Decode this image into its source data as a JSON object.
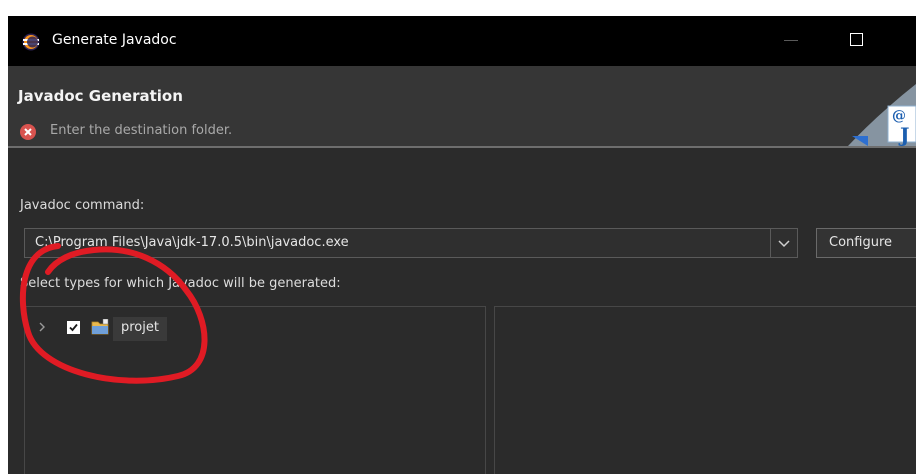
{
  "window": {
    "title": "Generate Javadoc"
  },
  "banner": {
    "title": "Javadoc Generation",
    "message": "Enter the destination folder."
  },
  "form": {
    "javadoc_command_label": "Javadoc command:",
    "javadoc_command_value": "C:\\Program Files\\Java\\jdk-17.0.5\\bin\\javadoc.exe",
    "configure_label": "Configure",
    "types_label": "Select types for which Javadoc will be generated:"
  },
  "tree": {
    "items": [
      {
        "label": "projet",
        "checked": true,
        "expanded": false
      }
    ]
  },
  "colors": {
    "titlebar": "#000000",
    "background": "#2b2b2b",
    "banner": "#363636",
    "annotation": "#e01b24",
    "error_icon": "#d9534f"
  },
  "icons": [
    "eclipse-icon",
    "error-icon",
    "javadoc-wizard-icon",
    "chevron-down-icon",
    "expand-chevron-icon",
    "checkbox-checked-icon",
    "project-folder-icon"
  ]
}
